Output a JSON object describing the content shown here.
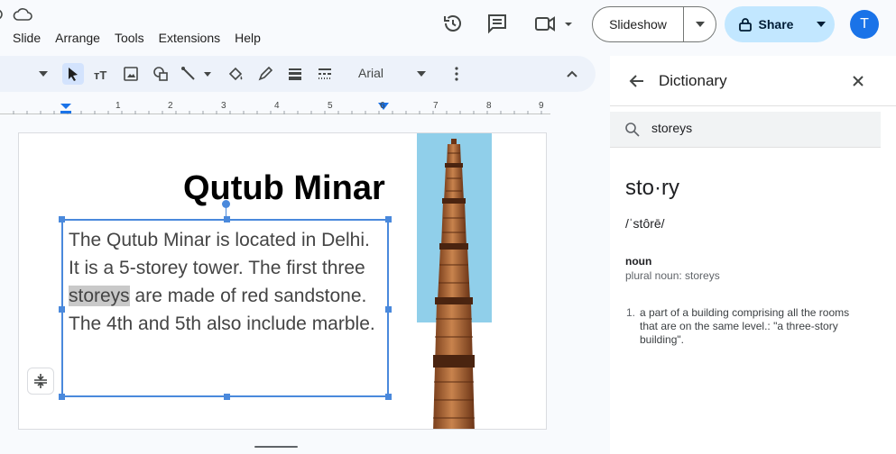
{
  "menu": [
    "Slide",
    "Arrange",
    "Tools",
    "Extensions",
    "Help"
  ],
  "header": {
    "slideshow_label": "Slideshow",
    "share_label": "Share",
    "avatar_initial": "T"
  },
  "toolbar": {
    "font": "Arial"
  },
  "ruler": {
    "numbers": [
      "1",
      "2",
      "3",
      "4",
      "5",
      "6",
      "7",
      "8",
      "9"
    ]
  },
  "slide": {
    "title": "Qutub Minar",
    "text_before": "The Qutub Minar is located in Delhi. It is a 5-storey tower. The first three ",
    "text_highlight": "storeys",
    "text_after": " are made of red sandstone. The 4th and 5th also include marble."
  },
  "dictionary": {
    "title": "Dictionary",
    "search_value": "storeys",
    "word": "sto·ry",
    "pronunciation": "/ˈstôrē/",
    "part_of_speech": "noun",
    "plural": "plural noun: storeys",
    "definition_number": "1.",
    "definition": "a part of a building comprising all the rooms that are on the same level.: \"a three-story building\"."
  },
  "colors": {
    "accent": "#1a73e8",
    "share_bg": "#c2e7ff",
    "selection": "#4a89dc",
    "sky": "#90cfea"
  }
}
